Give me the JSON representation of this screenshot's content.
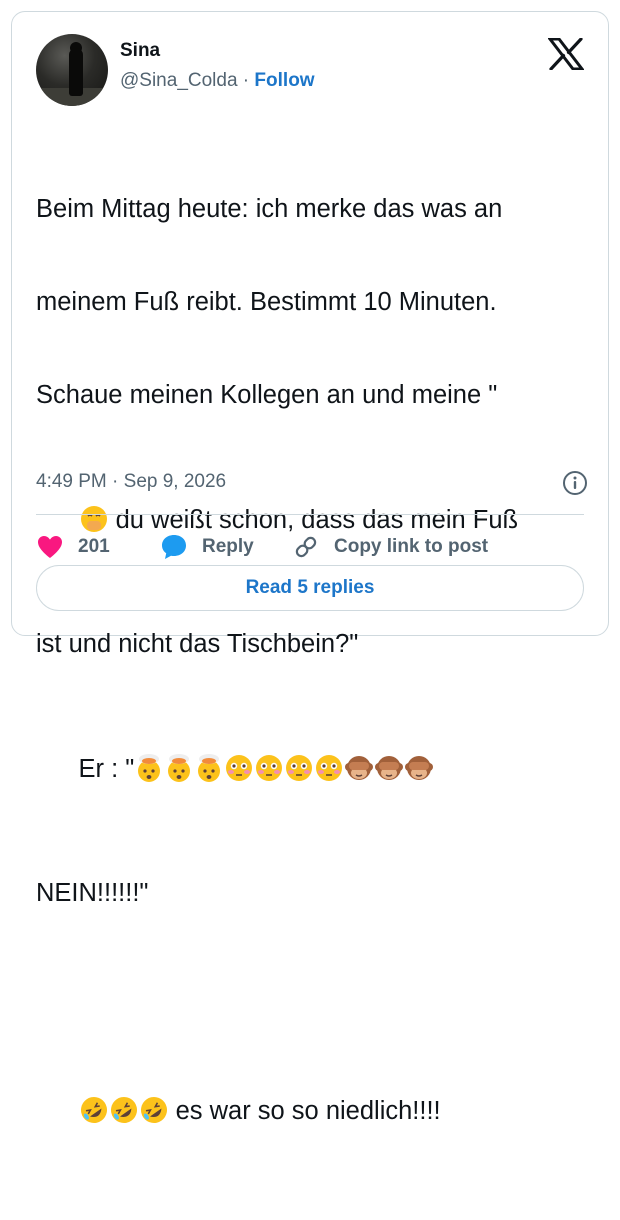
{
  "author": {
    "name": "Sina",
    "handle": "@Sina_Colda",
    "separator": " · ",
    "follow_label": "Follow"
  },
  "post": {
    "line_1": "Beim Mittag heute: ich merke das was an",
    "line_2": "meinem Fuß reibt. Bestimmt 10 Minuten.",
    "line_3": "Schaue meinen Kollegen an und meine \"",
    "line_4_text": " du weißt schon, dass das mein Fuß",
    "line_5": "ist und nicht das Tischbein?\"",
    "line_6_prefix": "Er : \"",
    "line_7": "NEIN!!!!!!\"",
    "line_9_text": " es war so so niedlich!!!!",
    "emoji": {
      "line_4": [
        "face-with-hand-over-mouth"
      ],
      "line_6": [
        "exploding-head",
        "exploding-head",
        "exploding-head",
        "flushed-face",
        "flushed-face",
        "flushed-face",
        "flushed-face",
        "see-no-evil-monkey",
        "see-no-evil-monkey",
        "see-no-evil-monkey"
      ],
      "line_9": [
        "rolling-on-floor-laughing",
        "rolling-on-floor-laughing",
        "rolling-on-floor-laughing"
      ]
    }
  },
  "meta": {
    "timestamp": "4:49 PM · Sep 9, 2026"
  },
  "actions": {
    "like_count": "201",
    "reply_label": "Reply",
    "copy_label": "Copy link to post"
  },
  "read_replies_label": "Read 5 replies",
  "colors": {
    "accent": "#1d76c9",
    "heart": "#f91880",
    "reply_bubble": "#1d9bf0",
    "muted": "#536471",
    "border": "#cfd9de"
  }
}
